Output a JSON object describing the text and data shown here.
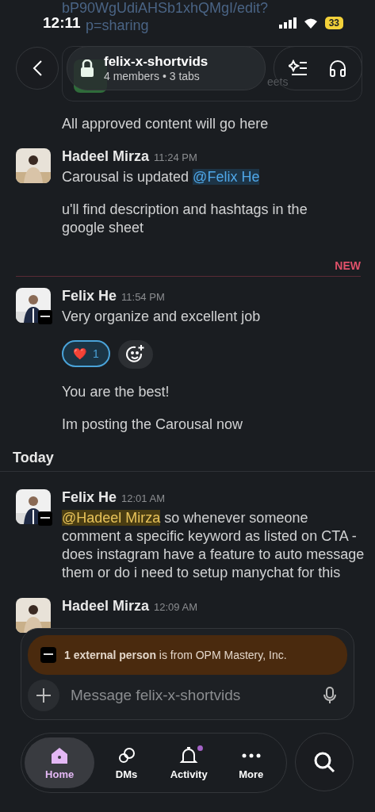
{
  "backdrop": {
    "url_lines": [
      "bP90WgUdiAHSb1xhQMgI/edit?",
      "p=sharing"
    ],
    "card_text": "eets"
  },
  "status_bar": {
    "time": "12:11",
    "battery": "33"
  },
  "header": {
    "channel": "felix-x-shortvids",
    "subtitle": "4 members • 3 tabs"
  },
  "intro": "All approved content will go here",
  "messages": [
    {
      "author": "Hadeel Mirza",
      "time": "11:24 PM",
      "badge": false,
      "paragraphs": [
        [
          {
            "kind": "plain",
            "text": "Carousal is updated "
          },
          {
            "kind": "mention",
            "text": "@Felix He"
          }
        ],
        [
          {
            "kind": "plain",
            "text": "u'll find description and hashtags in the google sheet"
          }
        ]
      ]
    },
    {
      "kind": "divider",
      "label": "NEW"
    },
    {
      "author": "Felix He",
      "time": "11:54 PM",
      "badge": true,
      "paragraphs": [
        [
          {
            "kind": "plain",
            "text": "Very organize and excellent job"
          }
        ]
      ],
      "reactions": [
        {
          "emoji": "❤️",
          "count": "1",
          "selected": true
        }
      ],
      "paragraphs_after": [
        [
          {
            "kind": "plain",
            "text": "You are the best!"
          }
        ],
        [
          {
            "kind": "plain",
            "text": "Im posting the Carousal now"
          }
        ]
      ]
    },
    {
      "kind": "day",
      "label": "Today"
    },
    {
      "author": "Felix He",
      "time": "12:01 AM",
      "badge": true,
      "paragraphs": [
        [
          {
            "kind": "self_mention",
            "text": "@Hadeel Mirza"
          },
          {
            "kind": "plain",
            "text": " so whenever someone comment a specific keyword as listed on CTA - does instagram have a feature to auto message them or do i need to setup manychat for this"
          }
        ]
      ]
    },
    {
      "author": "Hadeel Mirza",
      "time": "12:09 AM",
      "badge": false
    }
  ],
  "banner": {
    "text": "**1 external person** is from OPM Mastery, Inc."
  },
  "composer": {
    "placeholder": "Message felix-x-shortvids"
  },
  "nav": [
    {
      "label": "Home",
      "selected": true,
      "unread": false
    },
    {
      "label": "DMs",
      "selected": false,
      "unread": false
    },
    {
      "label": "Activity",
      "selected": false,
      "unread": true
    },
    {
      "label": "More",
      "selected": false,
      "unread": false
    }
  ]
}
